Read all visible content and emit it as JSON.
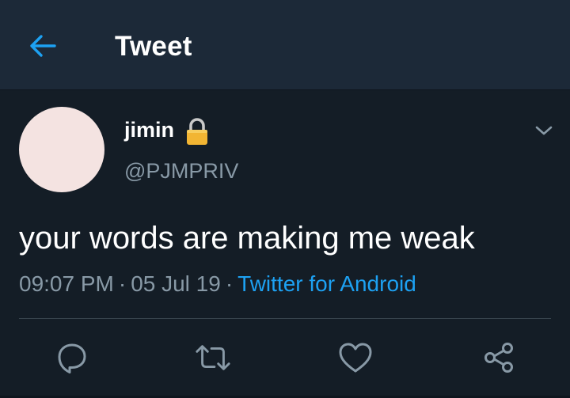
{
  "header": {
    "back_icon": "arrow-left-icon",
    "title": "Tweet"
  },
  "tweet": {
    "author": {
      "display_name": "jimin",
      "handle": "@PJMPRIV",
      "protected_icon": "lock-icon",
      "avatar_color": "#f4e3e1"
    },
    "menu_icon": "chevron-down-icon",
    "text": "your words are making me weak",
    "time": "09:07 PM",
    "separator": "·",
    "date": "05 Jul 19",
    "source": "Twitter for Android"
  },
  "actions": [
    {
      "icon": "reply-icon"
    },
    {
      "icon": "retweet-icon"
    },
    {
      "icon": "like-icon"
    },
    {
      "icon": "share-icon"
    }
  ],
  "colors": {
    "background": "#141d26",
    "header_bg": "#1c2938",
    "accent": "#1da1f2",
    "secondary_text": "#8899a6"
  }
}
